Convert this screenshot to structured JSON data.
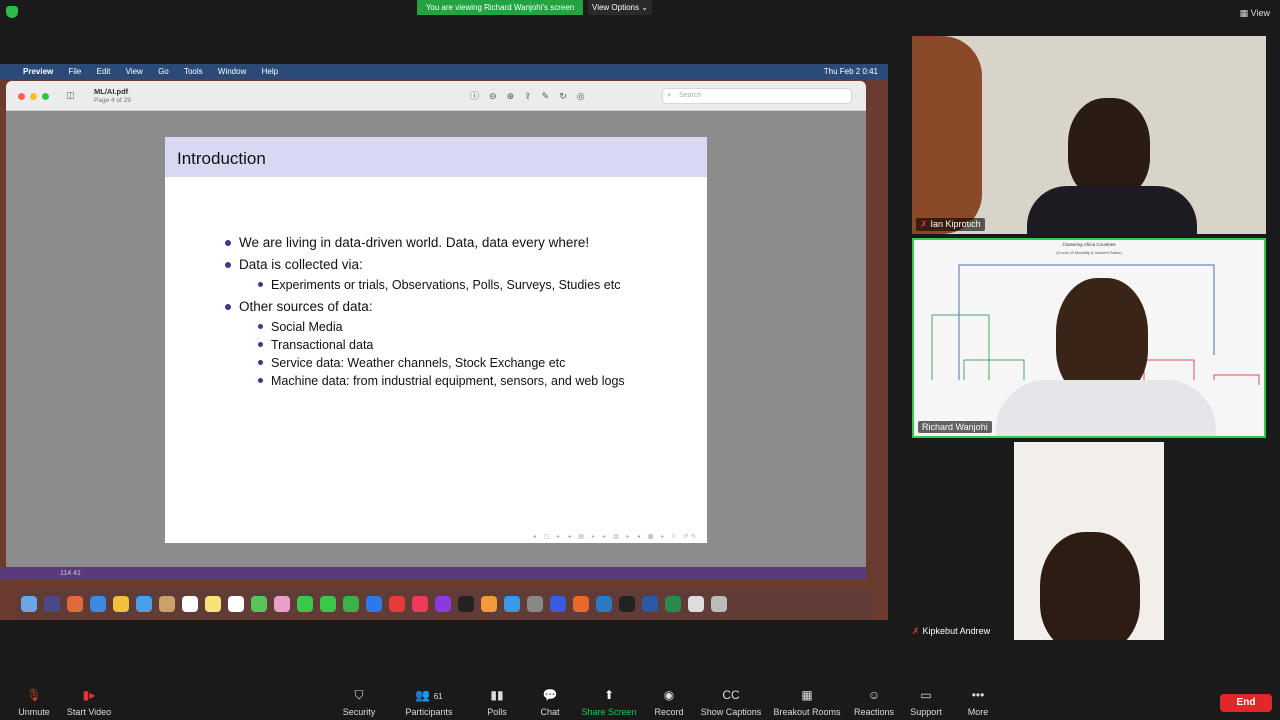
{
  "top": {
    "viewing": "You are viewing Richard Wanjohi's screen",
    "view_options": "View Options",
    "view": "View"
  },
  "menubar": {
    "apple": "",
    "app": "Preview",
    "items": [
      "File",
      "Edit",
      "View",
      "Go",
      "Tools",
      "Window",
      "Help"
    ],
    "clock": "Thu Feb 2 0:41"
  },
  "preview": {
    "filename": "ML/AI.pdf",
    "page": "Page 4 of 29",
    "search_placeholder": "Search"
  },
  "slide": {
    "title": "Introduction",
    "bullets": [
      {
        "text": "We are living in data-driven world.  Data, data every where!"
      },
      {
        "text": "Data is collected via:",
        "sub": [
          "Experiments or trials, Observations, Polls, Surveys, Studies etc"
        ]
      },
      {
        "text": "Other sources of data:",
        "sub": [
          "Social Media",
          "Transactional data",
          "Service data:  Weather channels, Stock Exchange etc",
          "Machine data:  from industrial equipment, sensors, and web logs"
        ]
      }
    ]
  },
  "status_strip": "114 41",
  "participants": [
    {
      "name": "Ian Kiprotich",
      "muted": true
    },
    {
      "name": "Richard Wanjohi",
      "muted": false
    },
    {
      "name": "Kipkebut Andrew",
      "muted": true
    }
  ],
  "chart_caption": {
    "title": "Clustering Africa Countries",
    "subtitle": "(Covid-19 Mortality & Incident Rates)"
  },
  "toolbar": {
    "unmute": "Unmute",
    "start_video": "Start Video",
    "security": "Security",
    "participants": "Participants",
    "participants_count": "61",
    "polls": "Polls",
    "chat": "Chat",
    "share_screen": "Share Screen",
    "record": "Record",
    "captions": "Show Captions",
    "breakout": "Breakout Rooms",
    "reactions": "Reactions",
    "support": "Support",
    "more": "More",
    "end": "End"
  }
}
